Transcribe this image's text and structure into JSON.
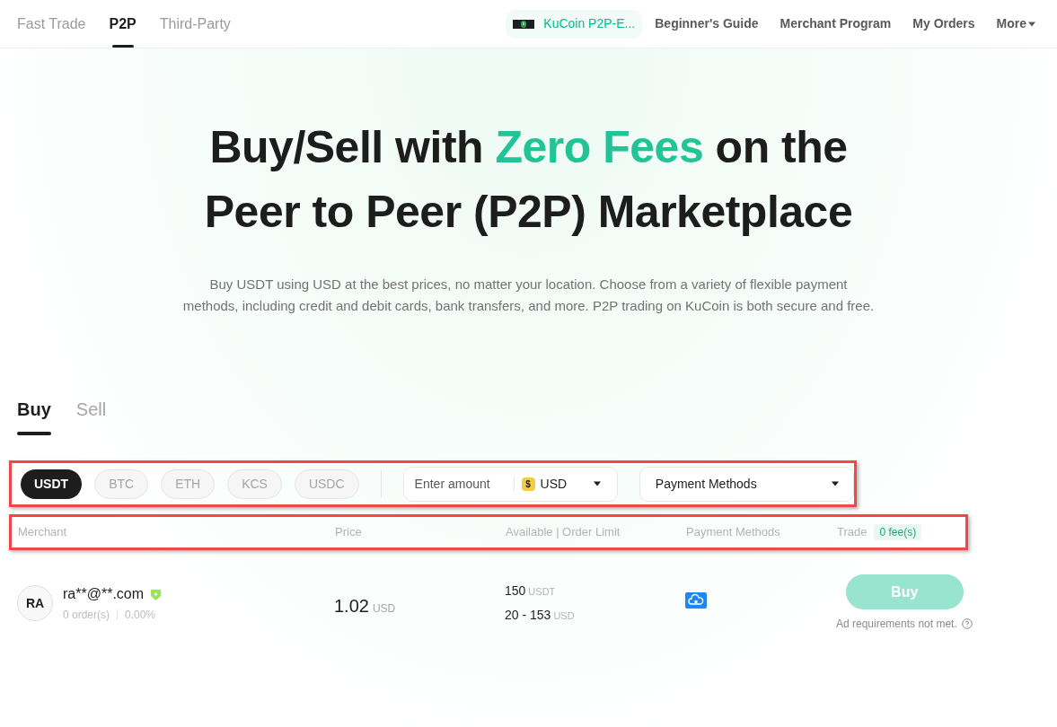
{
  "nav": {
    "tabs": [
      {
        "label": "Fast Trade",
        "selected": false
      },
      {
        "label": "P2P",
        "selected": true
      },
      {
        "label": "Third-Party",
        "selected": false
      }
    ],
    "promo": {
      "label": "KuCoin P2P-E..."
    },
    "links": [
      "Beginner's Guide",
      "Merchant Program",
      "My Orders"
    ],
    "more": {
      "label": "More"
    }
  },
  "hero": {
    "headline": [
      {
        "text": "Buy/Sell with ",
        "accent": false
      },
      {
        "text": "Zero Fees",
        "accent": true
      },
      {
        "text": " on the Peer to Peer (P2P) Marketplace",
        "accent": false
      }
    ],
    "subtitle": "Buy USDT using USD at the best prices, no matter your location. Choose from a variety of flexible payment methods, including credit and debit cards, bank transfers, and more. P2P trading on KuCoin is both secure and free."
  },
  "side_tabs": [
    {
      "label": "Buy",
      "selected": true
    },
    {
      "label": "Sell",
      "selected": false
    }
  ],
  "filters": {
    "highlighted": true,
    "coins": [
      {
        "label": "USDT",
        "selected": true
      },
      {
        "label": "BTC",
        "selected": false
      },
      {
        "label": "ETH",
        "selected": false
      },
      {
        "label": "KCS",
        "selected": false
      },
      {
        "label": "USDC",
        "selected": false
      }
    ],
    "amount": {
      "placeholder": "Enter amount",
      "currency_symbol": "$",
      "currency": "USD"
    },
    "payment": {
      "label": "Payment Methods"
    }
  },
  "table": {
    "highlighted": true,
    "columns": [
      "Merchant",
      "Price",
      "Available | Order Limit",
      "Payment Methods",
      "Trade"
    ],
    "fee_badge": "0 fee(s)",
    "rows": [
      {
        "avatar": "RA",
        "name": "ra**@**.com",
        "verified": true,
        "orders": "0 order(s)",
        "completion": "0.00%",
        "price": "1.02",
        "price_unit": "USD",
        "available": "150",
        "available_unit": "USDT",
        "limit": "20 - 153",
        "limit_unit": "USD",
        "action": "Buy",
        "disabled": true,
        "note": "Ad requirements not met."
      }
    ]
  }
}
